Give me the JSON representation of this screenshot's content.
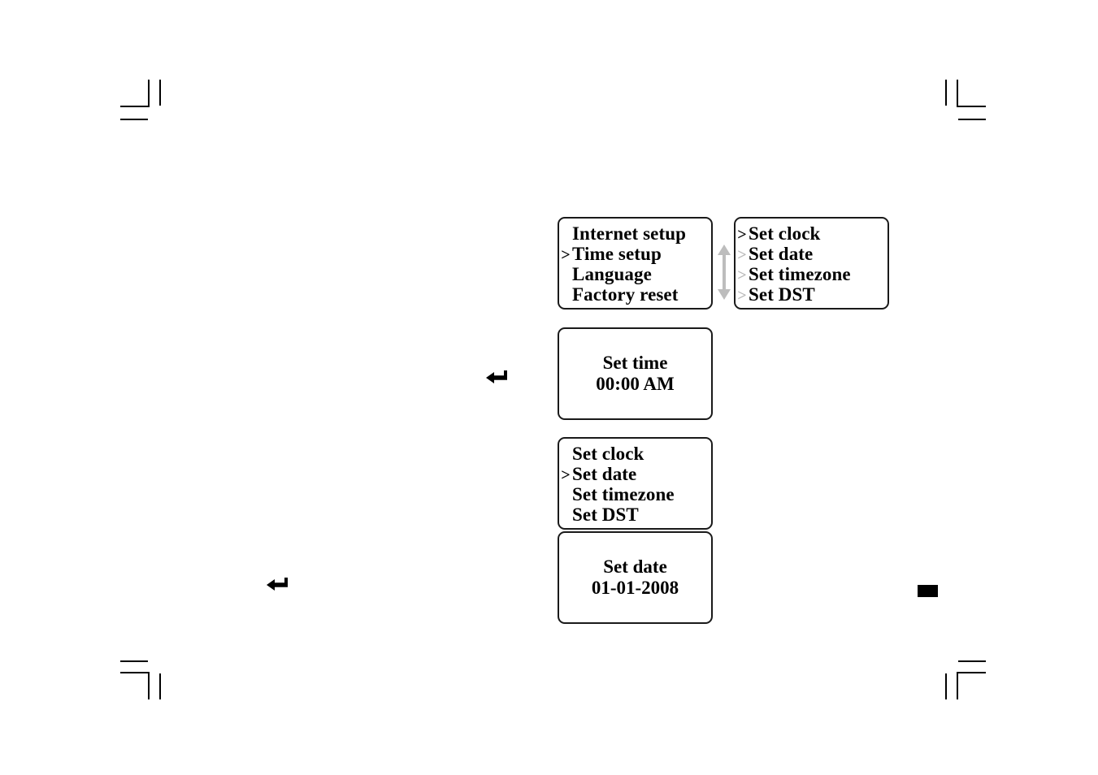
{
  "page": {
    "background_color": "#ffffff",
    "ink_color": "#000000",
    "muted_color": "#b9b9b9"
  },
  "screens": [
    {
      "id": "setup-menu",
      "type": "menu",
      "items": [
        {
          "label": "Internet setup",
          "marker": "none"
        },
        {
          "label": "Time setup",
          "marker": "selected"
        },
        {
          "label": "Language",
          "marker": "none"
        },
        {
          "label": "Factory reset",
          "marker": "none"
        }
      ]
    },
    {
      "id": "time-setup-menu",
      "type": "menu",
      "items": [
        {
          "label": "Set clock",
          "marker": "selected"
        },
        {
          "label": "Set date",
          "marker": "dim"
        },
        {
          "label": "Set timezone",
          "marker": "dim"
        },
        {
          "label": "Set DST",
          "marker": "dim"
        }
      ]
    },
    {
      "id": "set-time-value",
      "type": "value",
      "title": "Set time",
      "value": "00:00 AM"
    },
    {
      "id": "time-setup-menu-date",
      "type": "menu",
      "items": [
        {
          "label": "Set clock",
          "marker": "none"
        },
        {
          "label": "Set date",
          "marker": "selected"
        },
        {
          "label": "Set timezone",
          "marker": "none"
        },
        {
          "label": "Set DST",
          "marker": "none"
        }
      ]
    },
    {
      "id": "set-date-value",
      "type": "value",
      "title": "Set date",
      "value": "01-01-2008"
    }
  ],
  "glyphs": {
    "chevron_selected": ">",
    "chevron_dim": ">",
    "scroll_arrow": "up-down-arrow-icon",
    "return_arrow": "return-arrow-icon"
  },
  "marks": {
    "crop_mark": "crop-mark",
    "page_marker": "page-marker"
  }
}
